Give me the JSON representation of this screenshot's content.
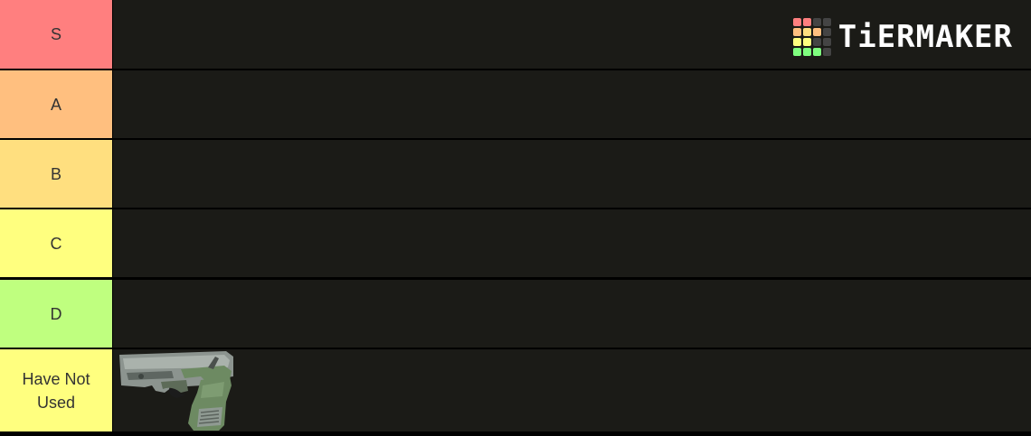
{
  "logo": {
    "text": "TiERMAKER",
    "grid_colors": [
      "#ff7f7f",
      "#ff7f7f",
      "#444444",
      "#444444",
      "#ffbf7f",
      "#ffdf7f",
      "#ffbf7f",
      "#444444",
      "#ffff7f",
      "#ffff7f",
      "#444444",
      "#444444",
      "#7fff7f",
      "#7fff7f",
      "#7fff7f",
      "#444444"
    ]
  },
  "tiers": [
    {
      "label": "S",
      "color": "#ff7f7f"
    },
    {
      "label": "A",
      "color": "#ffbf7f"
    },
    {
      "label": "B",
      "color": "#ffdf7f"
    },
    {
      "label": "C",
      "color": "#ffff7f"
    },
    {
      "label": "D",
      "color": "#bfff7f"
    },
    {
      "label": "Have Not Used",
      "color": "#ffff7f"
    }
  ],
  "items": [
    {
      "tier": 5,
      "icon": "pistol-icon"
    }
  ]
}
